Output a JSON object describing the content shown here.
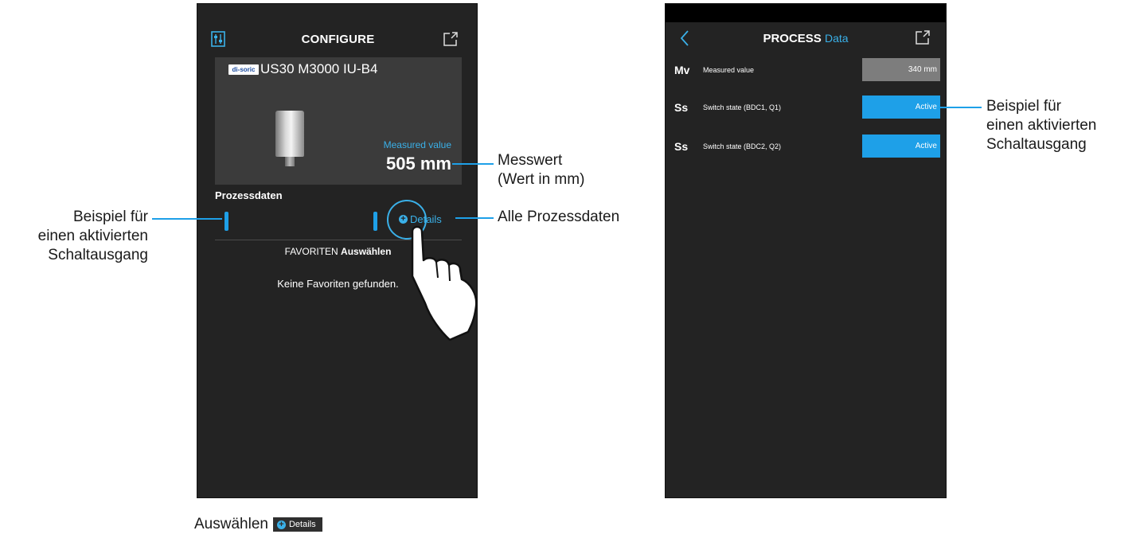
{
  "left_screen": {
    "header_title": "CONFIGURE",
    "device_name": "US30 M3000 IU-B4",
    "brand_logo_text": "di-soric",
    "measured_value_label": "Measured value",
    "measured_value": "505 mm",
    "process_heading": "Prozessdaten",
    "details_label": "Details",
    "favorites_prefix": "FAVORITEN",
    "favorites_action": "Auswählen",
    "no_favorites": "Keine Favoriten gefunden."
  },
  "right_screen": {
    "title_bold": "PROCESS",
    "title_accent": "Data",
    "rows": [
      {
        "abbr": "Mv",
        "name": "Measured value",
        "value": "340 mm",
        "style": "grey"
      },
      {
        "abbr": "Ss",
        "name": "Switch state (BDC1, Q1)",
        "value": "Active",
        "style": "blue"
      },
      {
        "abbr": "Ss",
        "name": "Switch state (BDC2, Q2)",
        "value": "Active",
        "style": "blue"
      }
    ]
  },
  "annotations": {
    "left_switch_line1": "Beispiel für",
    "left_switch_line2": "einen aktivierten",
    "left_switch_line3": "Schaltausgang",
    "measured_line1": "Messwert",
    "measured_line2": "(Wert in mm)",
    "all_process_data": "Alle Prozessdaten",
    "right_switch_line1": "Beispiel für",
    "right_switch_line2": "einen aktivierten",
    "right_switch_line3": "Schaltausgang"
  },
  "bottom_caption": {
    "text": "Auswählen",
    "chip_label": "Details"
  },
  "colors": {
    "accent": "#3ab0e8",
    "active_blue": "#1ea0e8",
    "screen_bg": "#232323",
    "card_bg": "#3b3b3b",
    "value_grey": "#7d7d7d"
  }
}
